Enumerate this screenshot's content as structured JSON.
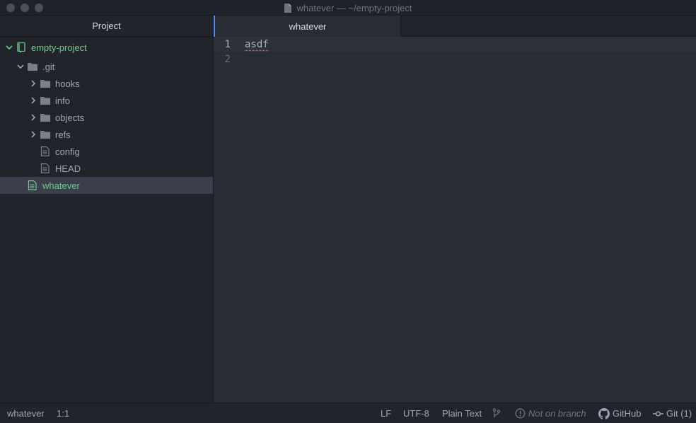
{
  "window": {
    "title": "whatever — ~/empty-project"
  },
  "tree": {
    "header": "Project",
    "items": [
      {
        "label": "empty-project",
        "type": "project"
      },
      {
        "label": ".git",
        "type": "folder-open"
      },
      {
        "label": "hooks",
        "type": "folder"
      },
      {
        "label": "info",
        "type": "folder"
      },
      {
        "label": "objects",
        "type": "folder"
      },
      {
        "label": "refs",
        "type": "folder"
      },
      {
        "label": "config",
        "type": "file"
      },
      {
        "label": "HEAD",
        "type": "file"
      },
      {
        "label": "whatever",
        "type": "file",
        "selected": true
      }
    ]
  },
  "editor": {
    "tab": "whatever",
    "lines": [
      {
        "number": "1",
        "text": "asdf"
      },
      {
        "number": "2",
        "text": ""
      }
    ]
  },
  "status": {
    "file": "whatever",
    "cursor": "1:1",
    "line_ending": "LF",
    "encoding": "UTF-8",
    "grammar": "Plain Text",
    "branch": "Not on branch",
    "github": "GitHub",
    "git": "Git (1)"
  },
  "colors": {
    "accent": "#568af2",
    "added_green": "#73c990",
    "background": "#282c34",
    "panel": "#21252b"
  }
}
